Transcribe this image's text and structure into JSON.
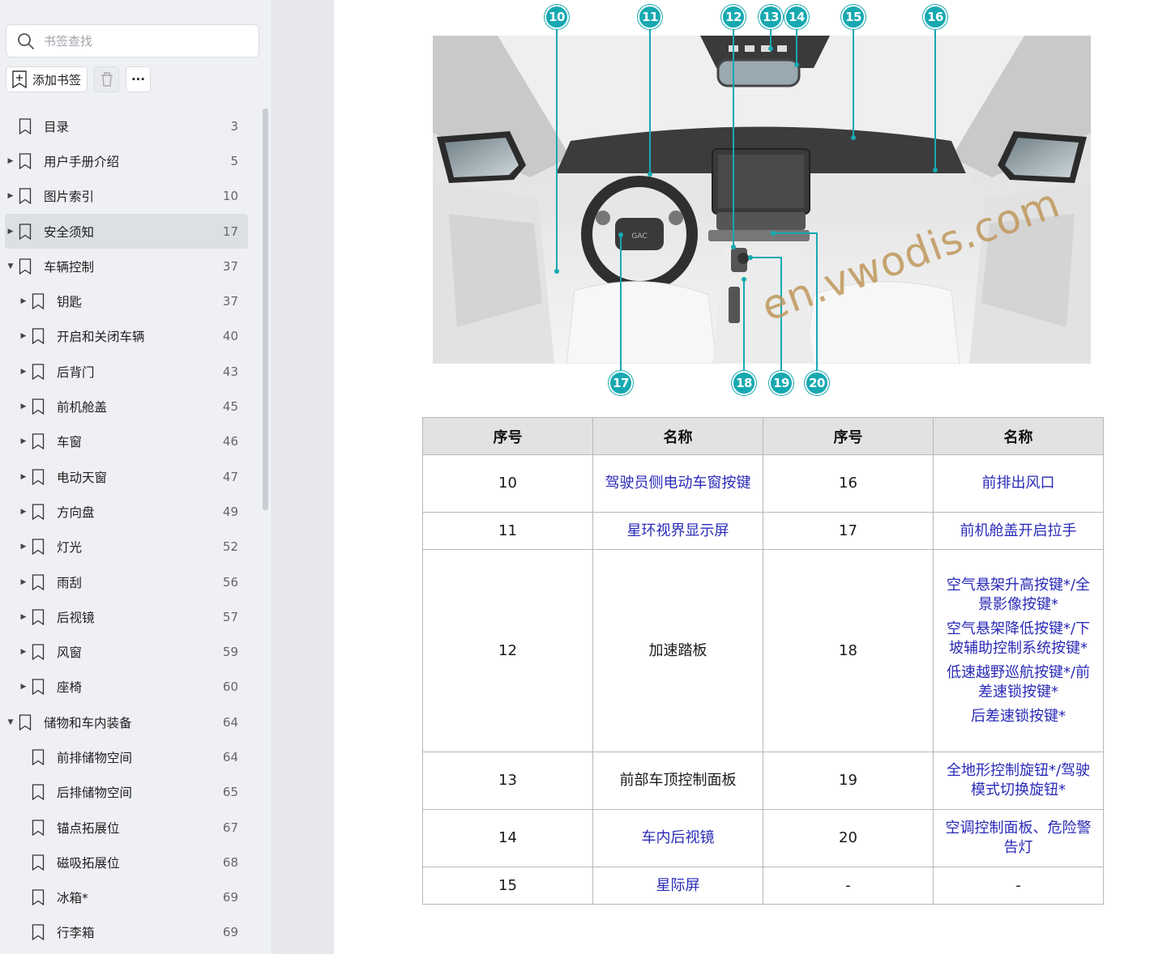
{
  "sidebar": {
    "search_placeholder": "书签查找",
    "add_bookmark_label": "添加书签",
    "more_label": "···",
    "items": [
      {
        "label": "目录",
        "page": "3",
        "level": 1,
        "caret": ""
      },
      {
        "label": "用户手册介绍",
        "page": "5",
        "level": 1,
        "caret": "▶"
      },
      {
        "label": "图片索引",
        "page": "10",
        "level": 1,
        "caret": "▶"
      },
      {
        "label": "安全须知",
        "page": "17",
        "level": 1,
        "caret": "▶",
        "active": true
      },
      {
        "label": "车辆控制",
        "page": "37",
        "level": 1,
        "caret": "▼"
      },
      {
        "label": "钥匙",
        "page": "37",
        "level": 2,
        "caret": "▶"
      },
      {
        "label": "开启和关闭车辆",
        "page": "40",
        "level": 2,
        "caret": "▶"
      },
      {
        "label": "后背门",
        "page": "43",
        "level": 2,
        "caret": "▶"
      },
      {
        "label": "前机舱盖",
        "page": "45",
        "level": 2,
        "caret": "▶"
      },
      {
        "label": "车窗",
        "page": "46",
        "level": 2,
        "caret": "▶"
      },
      {
        "label": "电动天窗",
        "page": "47",
        "level": 2,
        "caret": "▶"
      },
      {
        "label": "方向盘",
        "page": "49",
        "level": 2,
        "caret": "▶"
      },
      {
        "label": "灯光",
        "page": "52",
        "level": 2,
        "caret": "▶"
      },
      {
        "label": "雨刮",
        "page": "56",
        "level": 2,
        "caret": "▶"
      },
      {
        "label": "后视镜",
        "page": "57",
        "level": 2,
        "caret": "▶"
      },
      {
        "label": "风窗",
        "page": "59",
        "level": 2,
        "caret": "▶"
      },
      {
        "label": "座椅",
        "page": "60",
        "level": 2,
        "caret": "▶"
      },
      {
        "label": "储物和车内装备",
        "page": "64",
        "level": 1,
        "caret": "▼"
      },
      {
        "label": "前排储物空间",
        "page": "64",
        "level": 2,
        "caret": ""
      },
      {
        "label": "后排储物空间",
        "page": "65",
        "level": 2,
        "caret": ""
      },
      {
        "label": "锚点拓展位",
        "page": "67",
        "level": 2,
        "caret": ""
      },
      {
        "label": "磁吸拓展位",
        "page": "68",
        "level": 2,
        "caret": ""
      },
      {
        "label": "冰箱*",
        "page": "69",
        "level": 2,
        "caret": ""
      },
      {
        "label": "行李箱",
        "page": "69",
        "level": 2,
        "caret": ""
      }
    ]
  },
  "figure": {
    "callouts": [
      "10",
      "11",
      "12",
      "13",
      "14",
      "15",
      "16",
      "17",
      "18",
      "19",
      "20"
    ],
    "car_logo": "GAC"
  },
  "watermark": "en.vwodis.com",
  "table": {
    "headers": [
      "序号",
      "名称",
      "序号",
      "名称"
    ],
    "rows": [
      {
        "n1": "10",
        "name1": "驾驶员侧电动车窗按键",
        "n2": "16",
        "name2": [
          "前排出风口"
        ]
      },
      {
        "n1": "11",
        "name1": "星环视界显示屏",
        "n2": "17",
        "name2": [
          "前机舱盖开启拉手"
        ]
      },
      {
        "n1": "12",
        "name1": "加速踏板",
        "n2": "18",
        "name2": [
          "空气悬架升高按键*/全景影像按键*",
          "空气悬架降低按键*/下坡辅助控制系统按键*",
          "低速越野巡航按键*/前差速锁按键*",
          "后差速锁按键*"
        ]
      },
      {
        "n1": "13",
        "name1": "前部车顶控制面板",
        "n2": "19",
        "name2": [
          "全地形控制旋钮*/驾驶模式切换旋钮*"
        ]
      },
      {
        "n1": "14",
        "name1": "车内后视镜",
        "n2": "20",
        "name2": [
          "空调控制面板、危险警告灯"
        ]
      },
      {
        "n1": "15",
        "name1": "星际屏",
        "n2": "-",
        "name2": [
          "-"
        ]
      }
    ]
  }
}
